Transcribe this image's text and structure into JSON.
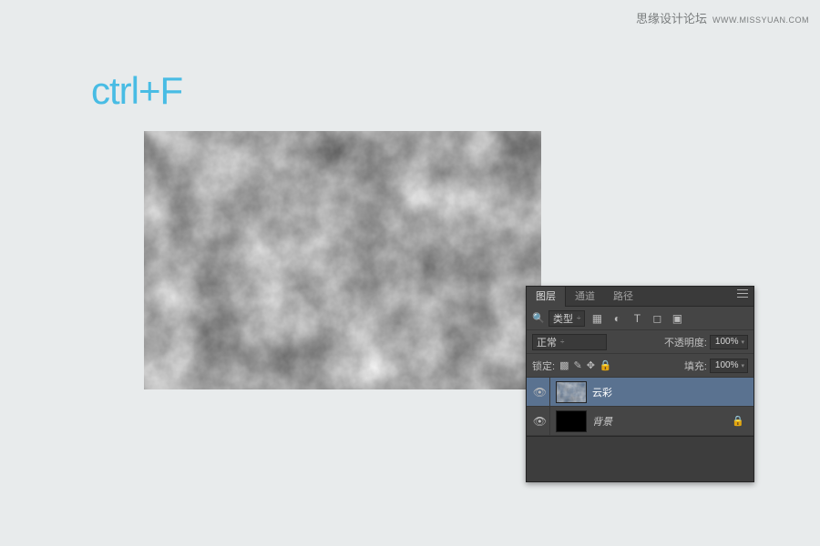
{
  "watermark": {
    "site": "思缘设计论坛",
    "url": "WWW.MISSYUAN.COM"
  },
  "title": "ctrl+F",
  "panel": {
    "tabs": [
      {
        "label": "图层",
        "active": true
      },
      {
        "label": "通道",
        "active": false
      },
      {
        "label": "路径",
        "active": false
      }
    ],
    "filter_label": "类型",
    "blend_mode": "正常",
    "opacity_label": "不透明度:",
    "opacity_value": "100%",
    "lock_label": "锁定:",
    "fill_label": "填充:",
    "fill_value": "100%",
    "layers": [
      {
        "name": "云彩",
        "selected": true,
        "locked": false,
        "visible": true,
        "thumb": "clouds"
      },
      {
        "name": "背景",
        "selected": false,
        "locked": true,
        "visible": true,
        "thumb": "solid"
      }
    ]
  }
}
